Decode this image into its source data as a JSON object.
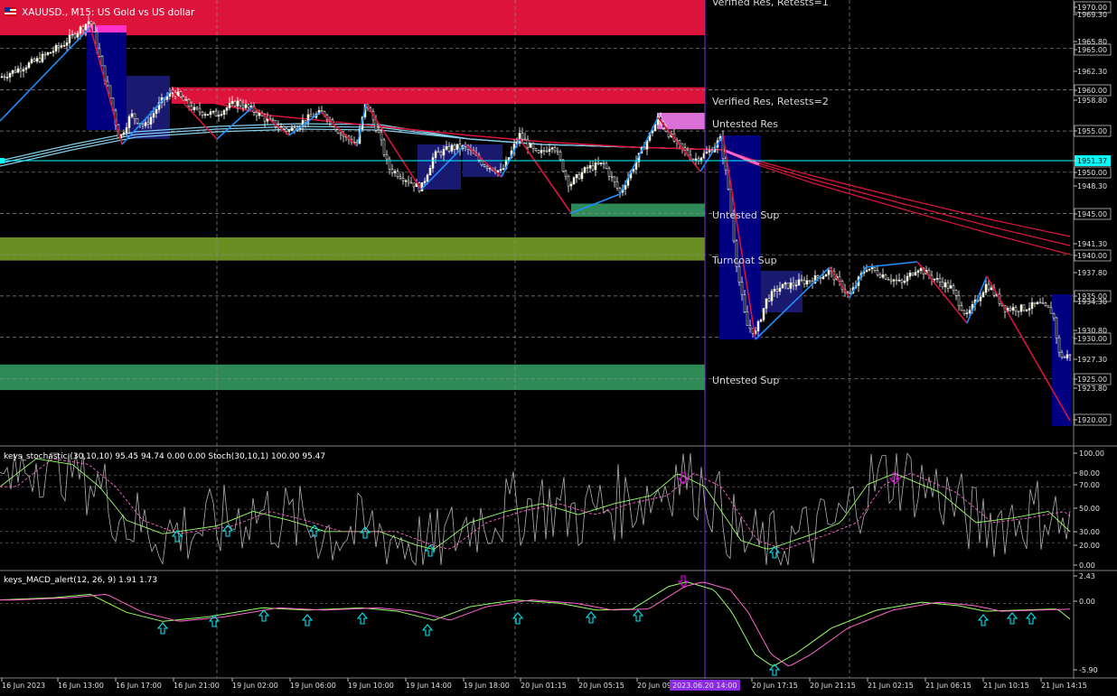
{
  "window": {
    "symbol_title": "XAUUSD., M15:  US Gold vs US dollar"
  },
  "colors": {
    "background": "#000000",
    "grid": "#c0c0c0",
    "bull_candle": "#ffffcc",
    "bear_candle": "#ffffff",
    "resistance_zone": "#dc143c",
    "untested_res_zone": "#da70d6",
    "support_zone_green": "#2e8b57",
    "turncoat_zone": "#6b8e23",
    "zigzag_up": "#1e90ff",
    "zigzag_down": "#dc143c",
    "ma_blue": "#87ceeb",
    "ma_red": "#dc143c",
    "price_line": "#00ffff",
    "macd_pink": "#ff66cc",
    "macd_green": "#99ff66",
    "signal_arrow_up": "#00e5ee",
    "signal_arrow_down": "#ee00ee",
    "vline": "#8a2be2"
  },
  "price_axis": {
    "labels": [
      "1970.00",
      "1969.30",
      "1965.80",
      "1965.00",
      "1962.30",
      "1960.00",
      "1958.80",
      "1955.00",
      "1951.37",
      "1950.00",
      "1948.30",
      "1945.00",
      "1941.30",
      "1940.00",
      "1937.80",
      "1935.00",
      "1934.30",
      "1930.80",
      "1930.00",
      "1927.30",
      "1925.00",
      "1923.80",
      "1920.00"
    ],
    "boxed": [
      "1970.00",
      "1965.00",
      "1960.00",
      "1955.00",
      "1950.00",
      "1945.00",
      "1940.00",
      "1935.00",
      "1930.00",
      "1925.00",
      "1920.00"
    ],
    "current_price": "1951.37"
  },
  "zones": [
    {
      "label": "Verified Res, Retests=1",
      "kind": "resistance",
      "top": 1970.3,
      "bottom": 1966.6,
      "start": 0,
      "end": 780
    },
    {
      "label": "Verified Res, Retests=2",
      "kind": "resistance",
      "top": 1960.3,
      "bottom": 1958.3,
      "start": 190,
      "end": 780
    },
    {
      "label": "Untested Res",
      "kind": "untested_res",
      "top": 1957.2,
      "bottom": 1955.2,
      "start": 727,
      "end": 780
    },
    {
      "label": "Untested Sup",
      "kind": "support_small",
      "top": 1946.2,
      "bottom": 1944.6,
      "start": 632,
      "end": 780
    },
    {
      "label": "Turncoat Sup",
      "kind": "turncoat",
      "top": 1942.1,
      "bottom": 1939.3,
      "start": 0,
      "end": 780
    },
    {
      "label": "Untested Sup",
      "kind": "support",
      "top": 1926.7,
      "bottom": 1923.6,
      "start": 0,
      "end": 780
    }
  ],
  "stochastic": {
    "title": "keys_stochastic (30,10,10) 95.45 94.74 0.00 0.00 Stoch(30,10,1) 100.00 95.47",
    "axis_labels": [
      "100.00",
      "80.00",
      "70.00",
      "50.00",
      "30.00",
      "20.00",
      "0.00"
    ]
  },
  "macd": {
    "title": "keys_MACD_alert(12, 26, 9) 1.91 1.73",
    "axis_labels": [
      "2.43",
      "0.00",
      "-5.90"
    ]
  },
  "time_axis": {
    "labels": [
      "16 Jun 2023",
      "16 Jun 13:00",
      "16 Jun 17:00",
      "16 Jun 21:00",
      "19 Jun 02:00",
      "19 Jun 06:00",
      "19 Jun 10:00",
      "19 Jun 14:00",
      "19 Jun 18:00",
      "20 Jun 01:15",
      "20 Jun 05:15",
      "20 Jun 09:15",
      "20 Jun 17:15",
      "20 Jun 21:15",
      "21 Jun 02:15",
      "21 Jun 06:15",
      "21 Jun 10:15",
      "21 Jun 14:15"
    ],
    "cursor_label": "2023.06.20 14:00"
  }
}
